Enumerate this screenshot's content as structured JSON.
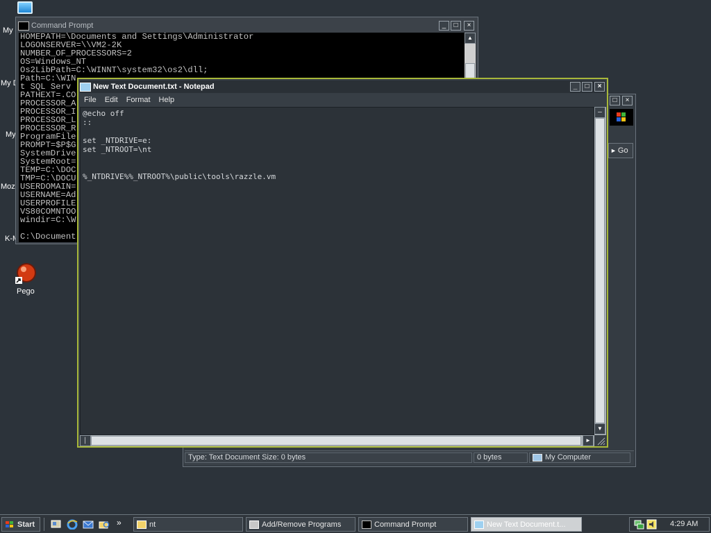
{
  "desktop": {
    "edge_labels": [
      "My",
      "My D",
      "My",
      "Moz",
      "K-M"
    ],
    "pego_label": "Pego"
  },
  "cmd": {
    "title": "Command Prompt",
    "lines": [
      "HOMEPATH=\\Documents and Settings\\Administrator",
      "LOGONSERVER=\\\\VM2-2K",
      "NUMBER_OF_PROCESSORS=2",
      "OS=Windows_NT",
      "Os2LibPath=C:\\WINNT\\system32\\os2\\dll;",
      "Path=C:\\WIN",
      "t SQL Serv",
      "PATHEXT=.CO",
      "PROCESSOR_A",
      "PROCESSOR_I",
      "PROCESSOR_L",
      "PROCESSOR_R",
      "ProgramFile",
      "PROMPT=$P$G",
      "SystemDrive",
      "SystemRoot=",
      "TEMP=C:\\DOC",
      "TMP=C:\\DOCU",
      "USERDOMAIN=",
      "USERNAME=Ad",
      "USERPROFILE",
      "VS80COMNTOO",
      "windir=C:\\W",
      "",
      "C:\\Document"
    ]
  },
  "explorer": {
    "go_label": "Go",
    "status_type": "Type: Text Document Size: 0 bytes",
    "status_size": "0 bytes",
    "status_zone": "My Computer"
  },
  "notepad": {
    "title": "New Text Document.txt - Notepad",
    "menu": [
      "File",
      "Edit",
      "Format",
      "Help"
    ],
    "content": "@echo off\n::\n\nset _NTDRIVE=e:\nset _NTROOT=\\nt\n\n\n%_NTDRIVE%%_NTROOT%\\public\\tools\\razzle.vm"
  },
  "taskbar": {
    "start_label": "Start",
    "buttons": [
      {
        "label": "nt",
        "icon": "folder-icon"
      },
      {
        "label": "Add/Remove Programs",
        "icon": "add-remove-icon"
      },
      {
        "label": "Command Prompt",
        "icon": "cmd-icon"
      },
      {
        "label": "New Text Document.t...",
        "icon": "notepad-icon"
      }
    ],
    "overflow_glyph": "»",
    "clock": "4:29 AM"
  },
  "colors": {
    "desktop": "#2c333a",
    "notepad_border": "#a8b83a",
    "cmd_background": "#000000",
    "cmd_text": "#c0c0c0"
  },
  "icons": {
    "window_buttons": [
      "minimize-icon",
      "maximize-icon",
      "close-icon"
    ],
    "quick_launch": [
      "show-desktop-icon",
      "internet-explorer-icon",
      "outlook-icon",
      "explorer-icon"
    ],
    "tray": [
      "network-icon",
      "volume-icon"
    ]
  }
}
